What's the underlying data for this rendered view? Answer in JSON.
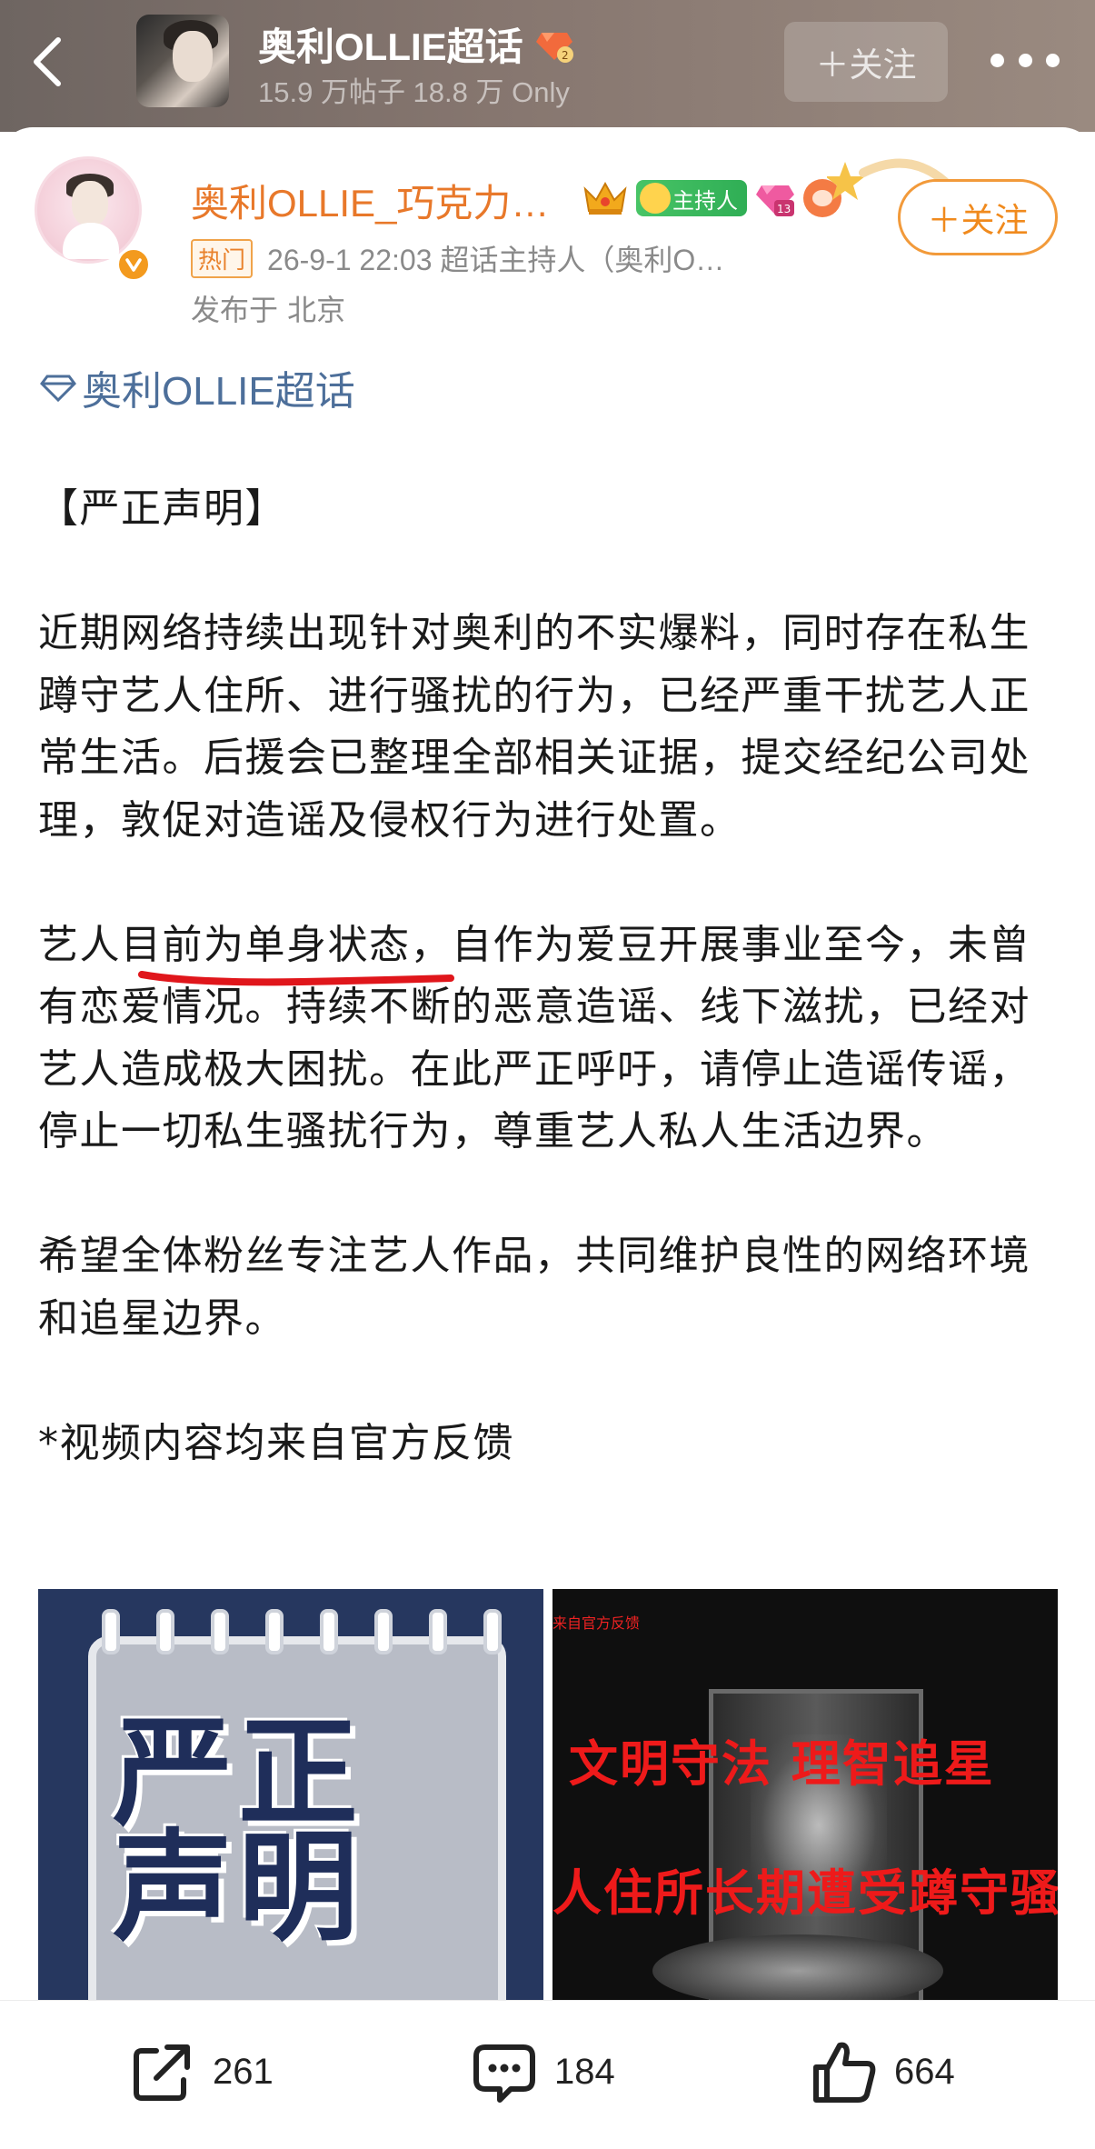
{
  "header": {
    "topic_title": "奥利OLLIE超话",
    "stats": "15.9 万帖子  18.8 万 Only",
    "follow_label": "＋关注"
  },
  "post": {
    "username": "奥利OLLIE_巧克力…",
    "host_badge": "主持人",
    "follow_label": "＋关注",
    "hot_tag": "热门",
    "meta": "26-9-1 22:03  超话主持人（奥利O…",
    "location": "发布于 北京",
    "topic_link": "奥利OLLIE超话",
    "paragraphs": [
      "【严正声明】",
      "近期网络持续出现针对奥利的不实爆料，同时存在私生蹲守艺人住所、进行骚扰的行为，已经严重干扰艺人正常生活。后援会已整理全部相关证据，提交经纪公司处理，敦促对造谣及侵权行为进行处置。",
      "艺人目前为单身状态，自作为爱豆开展事业至今，未曾有恋爱情况。持续不断的恶意造谣、线下滋扰，已经对艺人造成极大困扰。在此严正呼吁，请停止造谣传谣，停止一切私生骚扰行为，尊重艺人私人生活边界。",
      "希望全体粉丝专注艺人作品，共同维护良性的网络环境和追星边界。",
      "*视频内容均来自官方反馈"
    ]
  },
  "media": {
    "left_image_text": "严正声明",
    "right_tag": "来自官方反馈",
    "right_line1": "文明守法 理智追星",
    "right_line2": "人住所长期遭受蹲守骚"
  },
  "actions": {
    "share_count": "261",
    "comment_count": "184",
    "like_count": "664"
  }
}
